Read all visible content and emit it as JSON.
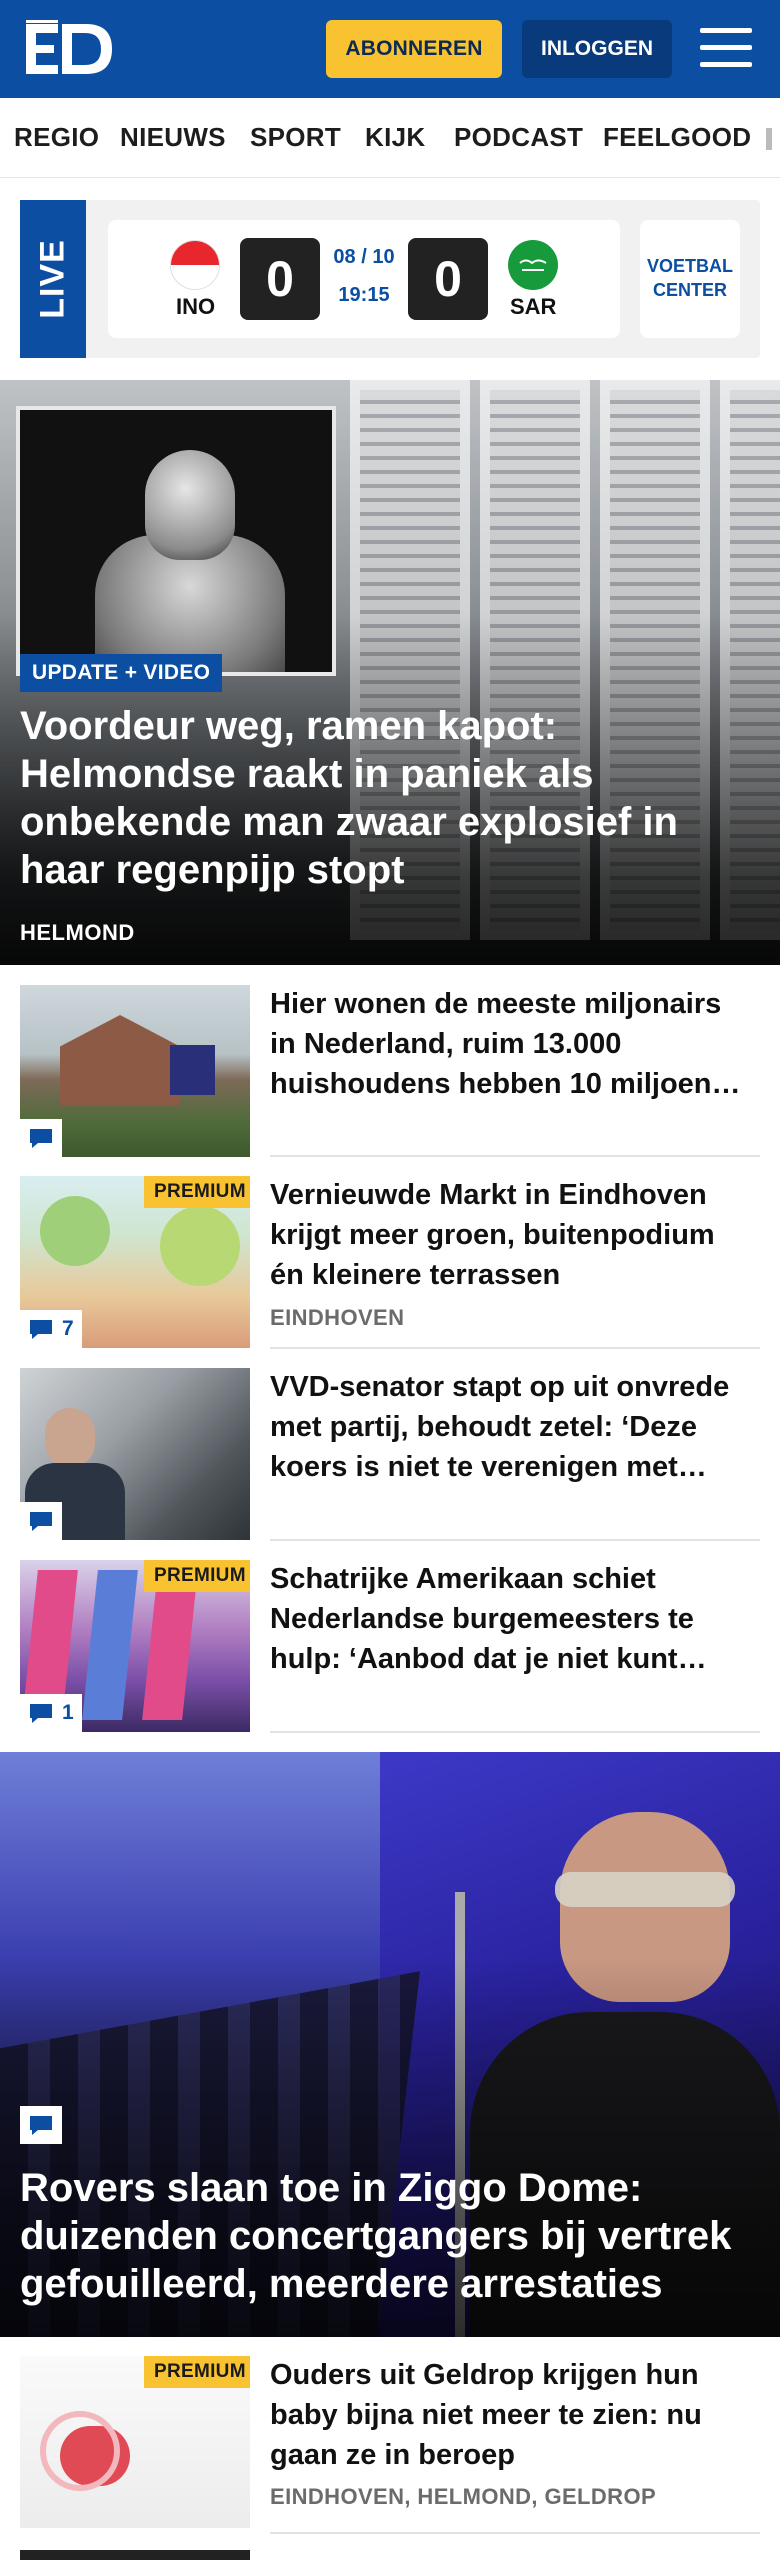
{
  "header": {
    "logo_text": "ED",
    "subscribe_label": "ABONNEREN",
    "login_label": "INLOGGEN",
    "brand_color": "#0b4ea2",
    "accent_color": "#f9c230"
  },
  "nav": {
    "items": [
      "REGIO",
      "NIEUWS",
      "SPORT",
      "KIJK",
      "PODCAST",
      "FEELGOOD"
    ]
  },
  "live": {
    "label": "LIVE",
    "home_team": "INO",
    "away_team": "SAR",
    "home_score": "0",
    "away_score": "0",
    "date": "08 / 10",
    "time": "19:15",
    "center_label_line1": "VOETBAL",
    "center_label_line2": "CENTER"
  },
  "hero": {
    "badge": "UPDATE + VIDEO",
    "title": "Voordeur weg, ramen kapot: Helmondse raakt in paniek als onbekende man zwaar explosief in haar regenpijp stopt",
    "location": "HELMOND"
  },
  "articles": [
    {
      "title": "Hier wonen de meeste miljonairs in Nederland, ruim 13.000 huishoudens hebben 10 miljoen…",
      "comments": "",
      "premium": false,
      "location": ""
    },
    {
      "title": "Vernieuwde Markt in Eindhoven krijgt meer groen, buitenpodium én kleinere terrassen",
      "comments": "7",
      "premium": true,
      "premium_label": "PREMIUM",
      "location": "EINDHOVEN"
    },
    {
      "title": "VVD-senator stapt op uit onvrede met partij, behoudt zetel: ‘Deze koers is niet te verenigen met…",
      "comments": "",
      "premium": false,
      "location": ""
    },
    {
      "title": "Schatrijke Amerikaan schiet Nederlandse burgemeesters te hulp: ‘Aanbod dat je niet kunt…",
      "comments": "1",
      "premium": true,
      "premium_label": "PREMIUM",
      "location": ""
    }
  ],
  "feature": {
    "title": "Rovers slaan toe in Ziggo Dome: duizenden concertgangers bij vertrek gefouilleerd, meerdere arrestaties"
  },
  "article_5": {
    "title": "Ouders uit Geldrop krijgen hun baby bijna niet meer te zien: nu gaan ze in beroep",
    "premium_label": "PREMIUM",
    "location": "EINDHOVEN, HELMOND, GELDROP"
  }
}
